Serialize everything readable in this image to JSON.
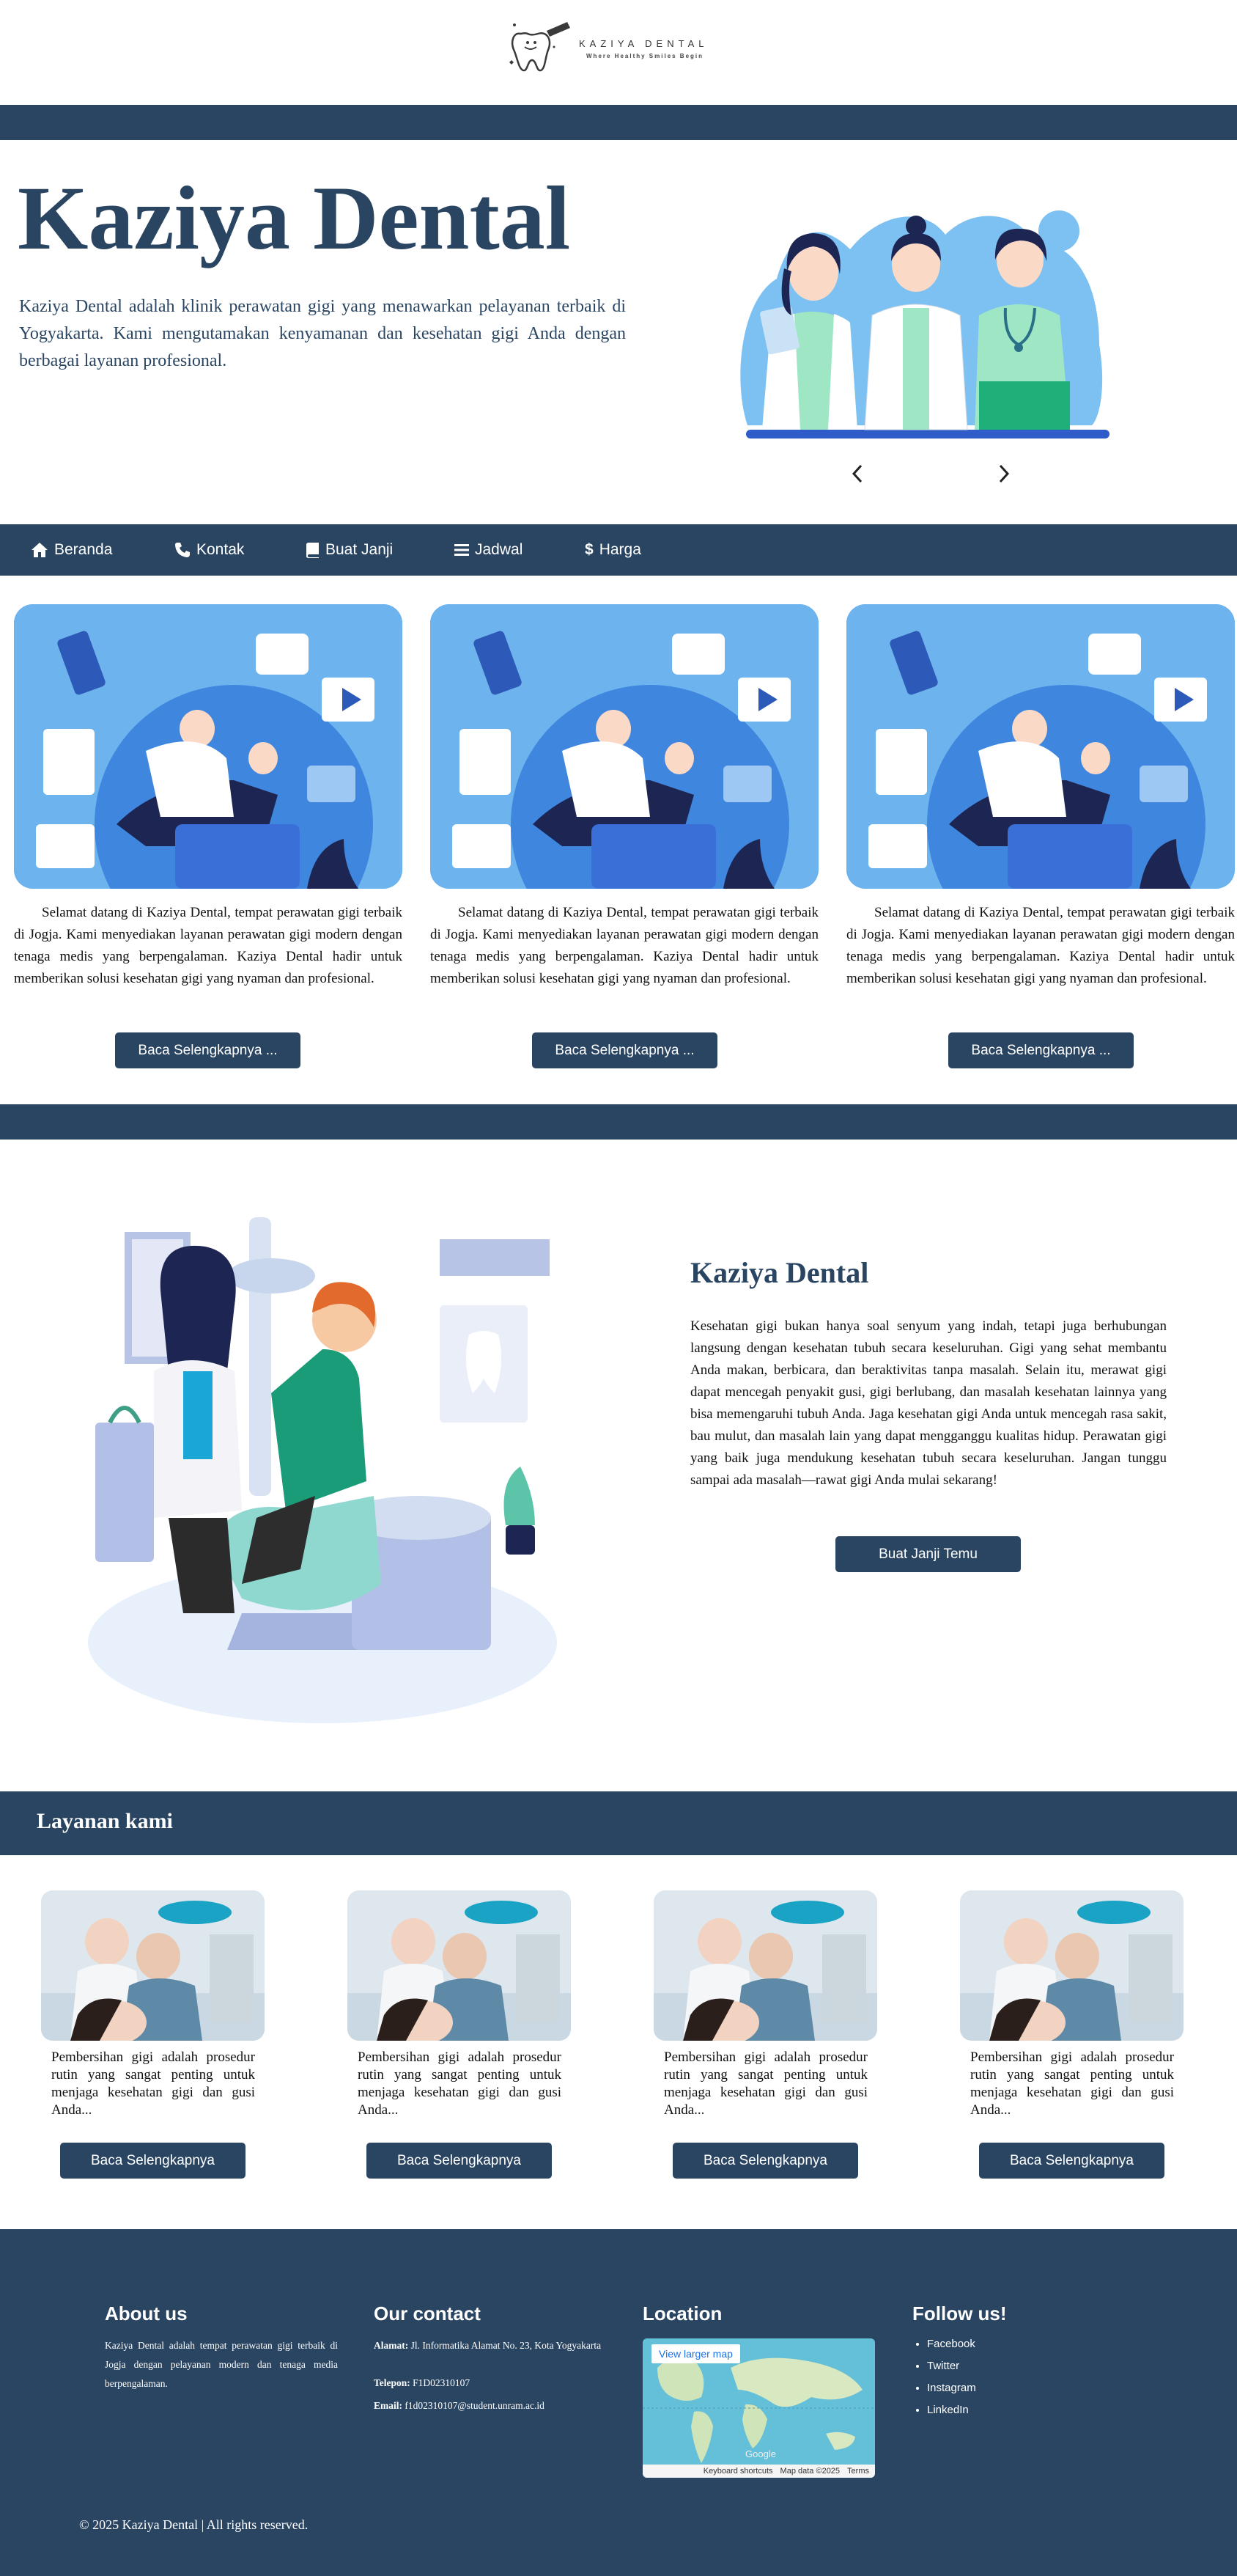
{
  "brand": {
    "name": "Kaziya Dental",
    "logo_text": "KAZIYA DENTAL",
    "logo_tagline": "Where Healthy Smiles Begin"
  },
  "hero": {
    "title": "Kaziya Dental",
    "description": "Kaziya Dental adalah klinik perawatan gigi yang menawarkan pelayanan terbaik di Yogyakarta. Kami mengutamakan kenyamanan dan kesehatan gigi Anda dengan berbagai layanan profesional.",
    "prev_icon": "chevron-left-icon",
    "next_icon": "chevron-right-icon"
  },
  "nav": {
    "items": [
      {
        "label": "Beranda",
        "icon": "home-icon"
      },
      {
        "label": "Kontak",
        "icon": "phone-icon"
      },
      {
        "label": "Buat Janji",
        "icon": "book-icon"
      },
      {
        "label": "Jadwal",
        "icon": "list-icon"
      },
      {
        "label": "Harga",
        "icon": "dollar-icon"
      }
    ]
  },
  "cards": {
    "text": "Selamat datang di Kaziya Dental, tempat perawatan gigi terbaik di Jogja. Kami menyediakan layanan perawatan gigi modern dengan tenaga medis yang berpengalaman. Kaziya Dental hadir untuk memberikan solusi kesehatan gigi yang nyaman dan profesional.",
    "button": "Baca Selengkapnya ..."
  },
  "about": {
    "title": "Kaziya Dental",
    "text": "Kesehatan gigi bukan hanya soal senyum yang indah, tetapi juga berhubungan langsung dengan kesehatan tubuh secara keseluruhan. Gigi yang sehat membantu Anda makan, berbicara, dan beraktivitas tanpa masalah. Selain itu, merawat gigi dapat mencegah penyakit gusi, gigi berlubang, dan masalah kesehatan lainnya yang bisa memengaruhi tubuh Anda. Jaga kesehatan gigi Anda untuk mencegah rasa sakit, bau mulut, dan masalah lain yang dapat mengganggu kualitas hidup. Perawatan gigi yang baik juga mendukung kesehatan tubuh secara keseluruhan. Jangan tunggu sampai ada masalah—rawat gigi Anda mulai sekarang!",
    "button": "Buat Janji Temu"
  },
  "services": {
    "heading": "Layanan kami",
    "text": "Pembersihan gigi adalah prosedur rutin yang sangat penting untuk menjaga kesehatan gigi dan gusi Anda...",
    "button": "Baca Selengkapnya"
  },
  "footer": {
    "about_heading": "About us",
    "about_text": "Kaziya Dental adalah tempat perawatan gigi terbaik di Jogja dengan pelayanan modern dan tenaga media berpengalaman.",
    "contact_heading": "Our contact",
    "address_label": "Alamat:",
    "address_value": " Jl. Informatika Alamat No. 23, Kota Yogyakarta",
    "phone_label": "Telepon:",
    "phone_value": " F1D02310107",
    "email_label": "Email:",
    "email_value": " f1d02310107@student.unram.ac.id",
    "location_heading": "Location",
    "map_link": "View larger map",
    "map_logo": "Google",
    "map_shortcuts": "Keyboard shortcuts",
    "map_data": "Map data ©2025",
    "map_terms": "Terms",
    "follow_heading": "Follow us!",
    "social": [
      "Facebook",
      "Twitter",
      "Instagram",
      "LinkedIn"
    ],
    "copyright": "© 2025 Kaziya Dental | All rights reserved."
  }
}
